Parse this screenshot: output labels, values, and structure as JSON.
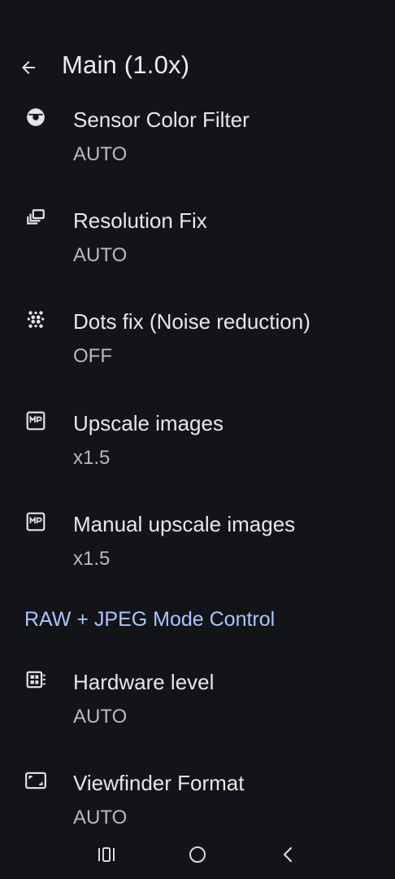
{
  "header": {
    "title": "Main (1.0x)",
    "back_icon": "arrow-back-icon"
  },
  "preferences": [
    {
      "title": "Sensor Color Filter",
      "summary": "AUTO",
      "icon": "camera-lens-icon"
    },
    {
      "title": "Resolution Fix",
      "summary": "AUTO",
      "icon": "photo-library-icon"
    },
    {
      "title": "Dots fix (Noise reduction)",
      "summary": "OFF",
      "icon": "dots-grid-icon"
    },
    {
      "title": "Upscale images",
      "summary": "x1.5",
      "icon": "mp-icon"
    },
    {
      "title": "Manual upscale images",
      "summary": "x1.5",
      "icon": "mp-icon"
    }
  ],
  "category": {
    "title": "RAW + JPEG Mode Control"
  },
  "preferences_raw": [
    {
      "title": "Hardware level",
      "summary": "AUTO",
      "icon": "memory-chip-icon"
    },
    {
      "title": "Viewfinder Format",
      "summary": "AUTO",
      "icon": "aspect-ratio-icon"
    }
  ],
  "navigation_bar": {
    "buttons": [
      "recent-apps-icon",
      "home-icon",
      "back-icon"
    ]
  },
  "colors": {
    "background": "#131418",
    "accent": "#a8c6ff",
    "text_primary": "#e6e6ec",
    "text_secondary": "#b9bac2"
  }
}
